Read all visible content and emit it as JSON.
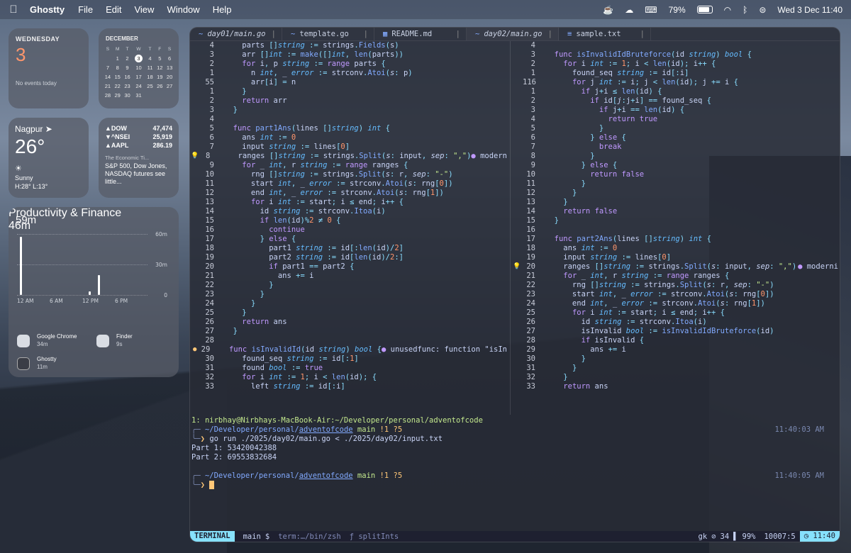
{
  "menubar": {
    "apple": "",
    "app": "Ghostty",
    "items": [
      "File",
      "Edit",
      "View",
      "Window",
      "Help"
    ],
    "battery": "79%",
    "datetime": "Wed 3 Dec  11:40"
  },
  "date_widget": {
    "weekday": "WEDNESDAY",
    "day": "3",
    "events": "No events today"
  },
  "calendar": {
    "month": "DECEMBER",
    "headers": [
      "S",
      "M",
      "T",
      "W",
      "T",
      "F",
      "S"
    ],
    "rows": [
      [
        "",
        "1",
        "2",
        "3",
        "4",
        "5",
        "6"
      ],
      [
        "7",
        "8",
        "9",
        "10",
        "11",
        "12",
        "13"
      ],
      [
        "14",
        "15",
        "16",
        "17",
        "18",
        "19",
        "20"
      ],
      [
        "21",
        "22",
        "23",
        "24",
        "25",
        "26",
        "27"
      ],
      [
        "28",
        "29",
        "30",
        "31",
        "",
        "",
        ""
      ]
    ],
    "today": "3"
  },
  "weather": {
    "city": "Nagpur",
    "temp": "26°",
    "condition": "Sunny",
    "hilo": "H:28° L:13°"
  },
  "stocks": {
    "rows": [
      {
        "sym": "▲DOW",
        "val": "47,474"
      },
      {
        "sym": "▼^NSEI",
        "val": "25,919"
      },
      {
        "sym": "▲AAPL",
        "val": "286.19"
      }
    ],
    "source": "The Economic Ti...",
    "headline": "S&P 500, Dow Jones, NASDAQ futures see little..."
  },
  "screentime": {
    "total": "59m",
    "gridlabels": [
      "60m",
      "30m",
      "0"
    ],
    "xlabels": [
      "12 AM",
      "6 AM",
      "12 PM",
      "6 PM"
    ],
    "bars": [
      {
        "pos": 0.02,
        "value": 0.95
      },
      {
        "pos": 0.55,
        "value": 0.06
      },
      {
        "pos": 0.62,
        "value": 0.33
      }
    ],
    "category": "Productivity & Finance",
    "category_time": "46m",
    "apps": [
      {
        "name": "Google Chrome",
        "time": "34m"
      },
      {
        "name": "Finder",
        "time": "9s"
      },
      {
        "name": "Ghostty",
        "time": "11m"
      }
    ]
  },
  "tabs": [
    {
      "label": "day01/main.go",
      "italic": true
    },
    {
      "label": "template.go",
      "italic": false
    },
    {
      "label": "README.md",
      "italic": false
    },
    {
      "label": "day02/main.go",
      "italic": true
    },
    {
      "label": "sample.txt",
      "italic": false
    }
  ],
  "left_code": [
    {
      "n": "4",
      "t": "    parts []string := strings.Fields(s)"
    },
    {
      "n": "3",
      "t": "    arr []int := make([]int, len(parts))"
    },
    {
      "n": "2",
      "t": "    for i, p string := range parts {"
    },
    {
      "n": "1",
      "t": "      n int, _ error := strconv.Atoi(s: p)"
    },
    {
      "n": "55",
      "t": "      arr[i] = n"
    },
    {
      "n": "1",
      "t": "    }"
    },
    {
      "n": "2",
      "t": "    return arr"
    },
    {
      "n": "3",
      "t": "  }"
    },
    {
      "n": "4",
      "t": ""
    },
    {
      "n": "5",
      "t": "  func part1Ans(lines []string) int {"
    },
    {
      "n": "6",
      "t": "    ans int := 0"
    },
    {
      "n": "7",
      "t": "    input string := lines[0]"
    },
    {
      "n": "8",
      "t": "    ranges []string := strings.Split(s: input, sep: \",\")",
      "hint": "modern",
      "g": "💡"
    },
    {
      "n": "9",
      "t": "    for _ int, r string := range ranges {"
    },
    {
      "n": "10",
      "t": "      rng []string := strings.Split(s: r, sep: \"-\")"
    },
    {
      "n": "11",
      "t": "      start int, _ error := strconv.Atoi(s: rng[0])"
    },
    {
      "n": "12",
      "t": "      end int, _ error := strconv.Atoi(s: rng[1])"
    },
    {
      "n": "13",
      "t": "      for i int := start; i ≤ end; i++ {"
    },
    {
      "n": "14",
      "t": "        id string := strconv.Itoa(i)"
    },
    {
      "n": "15",
      "t": "        if len(id)%2 ≠ 0 {"
    },
    {
      "n": "16",
      "t": "          continue"
    },
    {
      "n": "17",
      "t": "        } else {"
    },
    {
      "n": "18",
      "t": "          part1 string := id[:len(id)/2]"
    },
    {
      "n": "19",
      "t": "          part2 string := id[len(id)/2:]"
    },
    {
      "n": "20",
      "t": "          if part1 == part2 {"
    },
    {
      "n": "21",
      "t": "            ans += i"
    },
    {
      "n": "22",
      "t": "          }"
    },
    {
      "n": "23",
      "t": "        }"
    },
    {
      "n": "24",
      "t": "      }"
    },
    {
      "n": "25",
      "t": "    }"
    },
    {
      "n": "26",
      "t": "    return ans"
    },
    {
      "n": "27",
      "t": "  }"
    },
    {
      "n": "28",
      "t": ""
    },
    {
      "n": "29",
      "t": "  func isInvalidId(id string) bool {",
      "hint": "unusedfunc: function \"isIn",
      "g": "●"
    },
    {
      "n": "30",
      "t": "    found_seq string := id[:1]"
    },
    {
      "n": "31",
      "t": "    found bool := true"
    },
    {
      "n": "32",
      "t": "    for i int := 1; i < len(id); {"
    },
    {
      "n": "33",
      "t": "      left string := id[:i]"
    }
  ],
  "right_code": [
    {
      "n": "4",
      "t": ""
    },
    {
      "n": "3",
      "t": "  func isInvalidIdBruteforce(id string) bool {"
    },
    {
      "n": "2",
      "t": "    for i int := 1; i < len(id); i++ {"
    },
    {
      "n": "1",
      "t": "      found_seq string := id[:i]"
    },
    {
      "n": "116",
      "t": "      for j int := i; j < len(id); j += i {"
    },
    {
      "n": "1",
      "t": "        if j+i ≤ len(id) {"
    },
    {
      "n": "2",
      "t": "          if id[j:j+i] == found_seq {"
    },
    {
      "n": "3",
      "t": "            if j+i == len(id) {"
    },
    {
      "n": "4",
      "t": "              return true"
    },
    {
      "n": "5",
      "t": "            }"
    },
    {
      "n": "6",
      "t": "          } else {"
    },
    {
      "n": "7",
      "t": "            break"
    },
    {
      "n": "8",
      "t": "          }"
    },
    {
      "n": "9",
      "t": "        } else {"
    },
    {
      "n": "10",
      "t": "          return false"
    },
    {
      "n": "11",
      "t": "        }"
    },
    {
      "n": "12",
      "t": "      }"
    },
    {
      "n": "13",
      "t": "    }"
    },
    {
      "n": "14",
      "t": "    return false"
    },
    {
      "n": "15",
      "t": "  }"
    },
    {
      "n": "16",
      "t": ""
    },
    {
      "n": "17",
      "t": "  func part2Ans(lines []string) int {"
    },
    {
      "n": "18",
      "t": "    ans int := 0"
    },
    {
      "n": "19",
      "t": "    input string := lines[0]"
    },
    {
      "n": "20",
      "t": "    ranges []string := strings.Split(s: input, sep: \",\")",
      "hint": "moderni",
      "g": "💡"
    },
    {
      "n": "21",
      "t": "    for _ int, r string := range ranges {"
    },
    {
      "n": "22",
      "t": "      rng []string := strings.Split(s: r, sep: \"-\")"
    },
    {
      "n": "23",
      "t": "      start int, _ error := strconv.Atoi(s: rng[0])"
    },
    {
      "n": "24",
      "t": "      end int, _ error := strconv.Atoi(s: rng[1])"
    },
    {
      "n": "25",
      "t": "      for i int := start; i ≤ end; i++ {"
    },
    {
      "n": "26",
      "t": "        id string := strconv.Itoa(i)"
    },
    {
      "n": "27",
      "t": "        isInvalid bool := isInvalidIdBruteforce(id)"
    },
    {
      "n": "28",
      "t": "        if isInvalid {"
    },
    {
      "n": "29",
      "t": "          ans += i"
    },
    {
      "n": "30",
      "t": "        }"
    },
    {
      "n": "31",
      "t": "      }"
    },
    {
      "n": "32",
      "t": "    }"
    },
    {
      "n": "33",
      "t": "    return ans"
    }
  ],
  "console": {
    "title": "1: nirbhay@Nirbhays-MacBook-Air:~/Developer/personal/adventofcode",
    "prompt1_path": "~/Developer/personal/",
    "prompt1_dir": "adventofcode",
    "prompt1_branch": "main",
    "prompt1_status": "!1 ?5",
    "prompt1_time": "11:40:03 AM",
    "command": "go run ./2025/day02/main.go < ./2025/day02/input.txt",
    "out1": "Part 1: 53420042388",
    "out2": "Part 2: 69553832684",
    "prompt2_path": "~/Developer/personal/",
    "prompt2_dir": "adventofcode",
    "prompt2_branch": "main",
    "prompt2_status": "!1 ?5",
    "prompt2_time": "11:40:05 AM"
  },
  "statusbar": {
    "mode": "TERMINAL",
    "branch": "main",
    "shell_mark": "$",
    "term": "term:…/bin/zsh",
    "func": "ƒ splitInts",
    "gk": "gk",
    "diag": "34",
    "pct": "99%",
    "pos": "10007:5",
    "clock": "11:40"
  }
}
